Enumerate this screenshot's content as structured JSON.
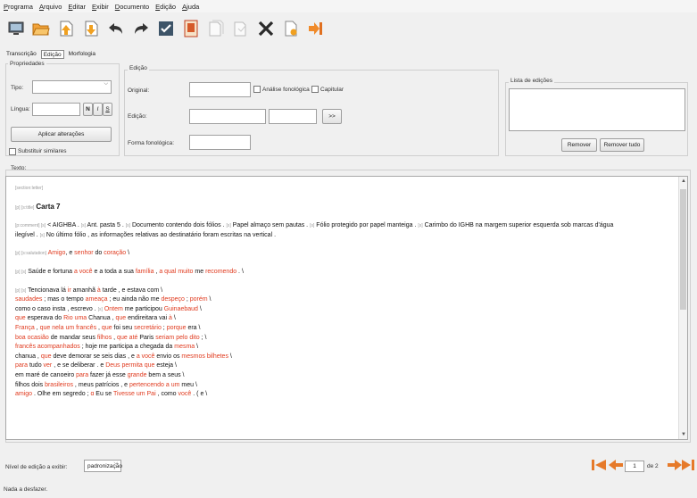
{
  "menu": [
    "Programa",
    "Arquivo",
    "Editar",
    "Exibir",
    "Documento",
    "Edição",
    "Ajuda"
  ],
  "toolbar_icons": [
    "monitor-icon",
    "open-folder-icon",
    "page-up-icon",
    "page-down-icon",
    "undo-icon",
    "redo-icon",
    "check-icon",
    "image-icon",
    "copy-page-icon",
    "paste-page-icon",
    "delete-icon",
    "new-document-icon",
    "exit-icon"
  ],
  "tabs": [
    "Transcrição",
    "Edição",
    "Morfologia"
  ],
  "propriedades": {
    "title": "Propriedades",
    "tipo_label": "Tipo:",
    "lingua_label": "Língua:",
    "format_buttons": [
      "N",
      "I",
      "S"
    ],
    "apply_label": "Aplicar alterações",
    "substituir_label": "Substituir similares"
  },
  "edicao": {
    "title": "Edição",
    "original_label": "Original:",
    "analise_label": "Análise fonológica",
    "capitular_label": "Capitular",
    "edicao_label": "Edição:",
    "next_label": ">>",
    "forma_label": "Forma fonológica:"
  },
  "lista": {
    "title": "Lista de edições",
    "remover_label": "Remover",
    "remover_tudo_label": "Remover tudo"
  },
  "texto_label": "Texto:",
  "text": {
    "p0": "[section:letter]",
    "p1_tag": "[p] [s:title]",
    "p1_title": "Carta 7",
    "p2_tag": "[p:comment] [s]",
    "p2_a": "< AIGHBA ",
    "p2_t1": "[s]",
    "p2_b": "Ant. pasta 5 ",
    "p2_t2": "[s]",
    "p2_c": "Documento contendo dois fólios ",
    "p2_t3": "[s]",
    "p2_d": "Papel almaço sem pautas ",
    "p2_t4": "[s]",
    "p2_e": "Fólio protegido por papel manteiga ",
    "p2_t5": "[s]",
    "p2_f": "Carimbo do IGHB na margem superior esquerda sob marcas d'água",
    "p2_g": "ilegível ",
    "p2_t6": "[s]",
    "p2_h": "No último fólio , as informações relativas ao destinatário foram escritas na vertical .",
    "p3_tag": "[p] [s:salutation]",
    "p3_a": "Amigo",
    "p3_b": ", e ",
    "p3_c": "senhor",
    "p3_d": " do ",
    "p3_e": "coração",
    "p3_f": " \\",
    "p4_tag": "[p] [s]",
    "p4_a": "Saúde e fortuna ",
    "p4_b": "a você",
    "p4_c": " e a toda a sua ",
    "p4_d": "família",
    "p4_e": " , ",
    "p4_f": "a qual muito",
    "p4_g": " me ",
    "p4_h": "recomendo",
    "p4_i": " . \\",
    "p5_tag": "[p] [s]",
    "p5_l1a": "Tencionava lá ",
    "p5_l1b": "ir",
    "p5_l1c": " amanhã ",
    "p5_l1d": "à",
    "p5_l1e": " tarde , e estava com \\",
    "p5_l2a": "saudades",
    "p5_l2b": " ; mas o tempo ",
    "p5_l2c": "ameaça",
    "p5_l2d": " ; eu ainda não me ",
    "p5_l2e": "despeço",
    "p5_l2f": " ; ",
    "p5_l2g": "porém",
    "p5_l2h": " \\",
    "p5_l3a": "como o caso insta , escrevo . ",
    "p5_l3t": "[s]",
    "p5_l3b": "Ontem",
    "p5_l3c": " me participou ",
    "p5_l3d": "Guinaebaud",
    "p5_l3e": " \\",
    "p5_l4a": "que",
    "p5_l4b": " esperava do ",
    "p5_l4c": "Rio uma",
    "p5_l4d": " Chanua , ",
    "p5_l4e": "que",
    "p5_l4f": " endireitara vai ",
    "p5_l4g": "à",
    "p5_l4h": " \\",
    "p5_l5a": "França",
    "p5_l5b": " , ",
    "p5_l5c": "que nela um francês",
    "p5_l5d": " , ",
    "p5_l5e": "que",
    "p5_l5f": " foi seu ",
    "p5_l5g": "secretário",
    "p5_l5h": " ; ",
    "p5_l5i": "porque",
    "p5_l5j": " era \\",
    "p5_l6a": "boa ocasião",
    "p5_l6b": " de mandar seus ",
    "p5_l6c": "filhos",
    "p5_l6d": " , ",
    "p5_l6e": "que até",
    "p5_l6f": " Paris ",
    "p5_l6g": "seriam pelo dito",
    "p5_l6h": " ; \\",
    "p5_l7a": "francês acompanhados",
    "p5_l7b": " ; hoje me participa a chegada da ",
    "p5_l7c": "mesma",
    "p5_l7d": " \\",
    "p5_l8a": "chanua , ",
    "p5_l8b": "que",
    "p5_l8c": " deve demorar se seis dias , e ",
    "p5_l8d": "a você",
    "p5_l8e": " envio os ",
    "p5_l8f": "mesmos bilhetes",
    "p5_l8g": " \\",
    "p5_l9a": "para",
    "p5_l9b": " tudo ",
    "p5_l9c": "ver",
    "p5_l9d": " , e se deliberar . e ",
    "p5_l9e": "Deus permita que",
    "p5_l9f": " esteja \\",
    "p5_l10a": "em maré de canoeiro ",
    "p5_l10b": "para",
    "p5_l10c": " fazer já esse ",
    "p5_l10d": "grande",
    "p5_l10e": " bem a seus \\",
    "p5_l11a": "filhos dois ",
    "p5_l11b": "brasileiros",
    "p5_l11c": " , meus patrícios , e ",
    "p5_l11d": "pertencendo a um",
    "p5_l11e": " meu \\",
    "p5_l12a": "amigo",
    "p5_l12b": " . Olhe em segredo ; ",
    "p5_l12c": "ɑ",
    "p5_l12d": " Eu se ",
    "p5_l12e": "Tivesse um Pai",
    "p5_l12f": " , como ",
    "p5_l12g": "você",
    "p5_l12h": " . ( e \\"
  },
  "nivel_label": "Nível de edição a exibir:",
  "nivel_value": "padronização",
  "page_current": "1",
  "page_total": "de 2",
  "status": "Nada a desfazer.",
  "colors": {
    "accent_red": "#e03a1e",
    "nav_orange": "#e67a2a"
  }
}
